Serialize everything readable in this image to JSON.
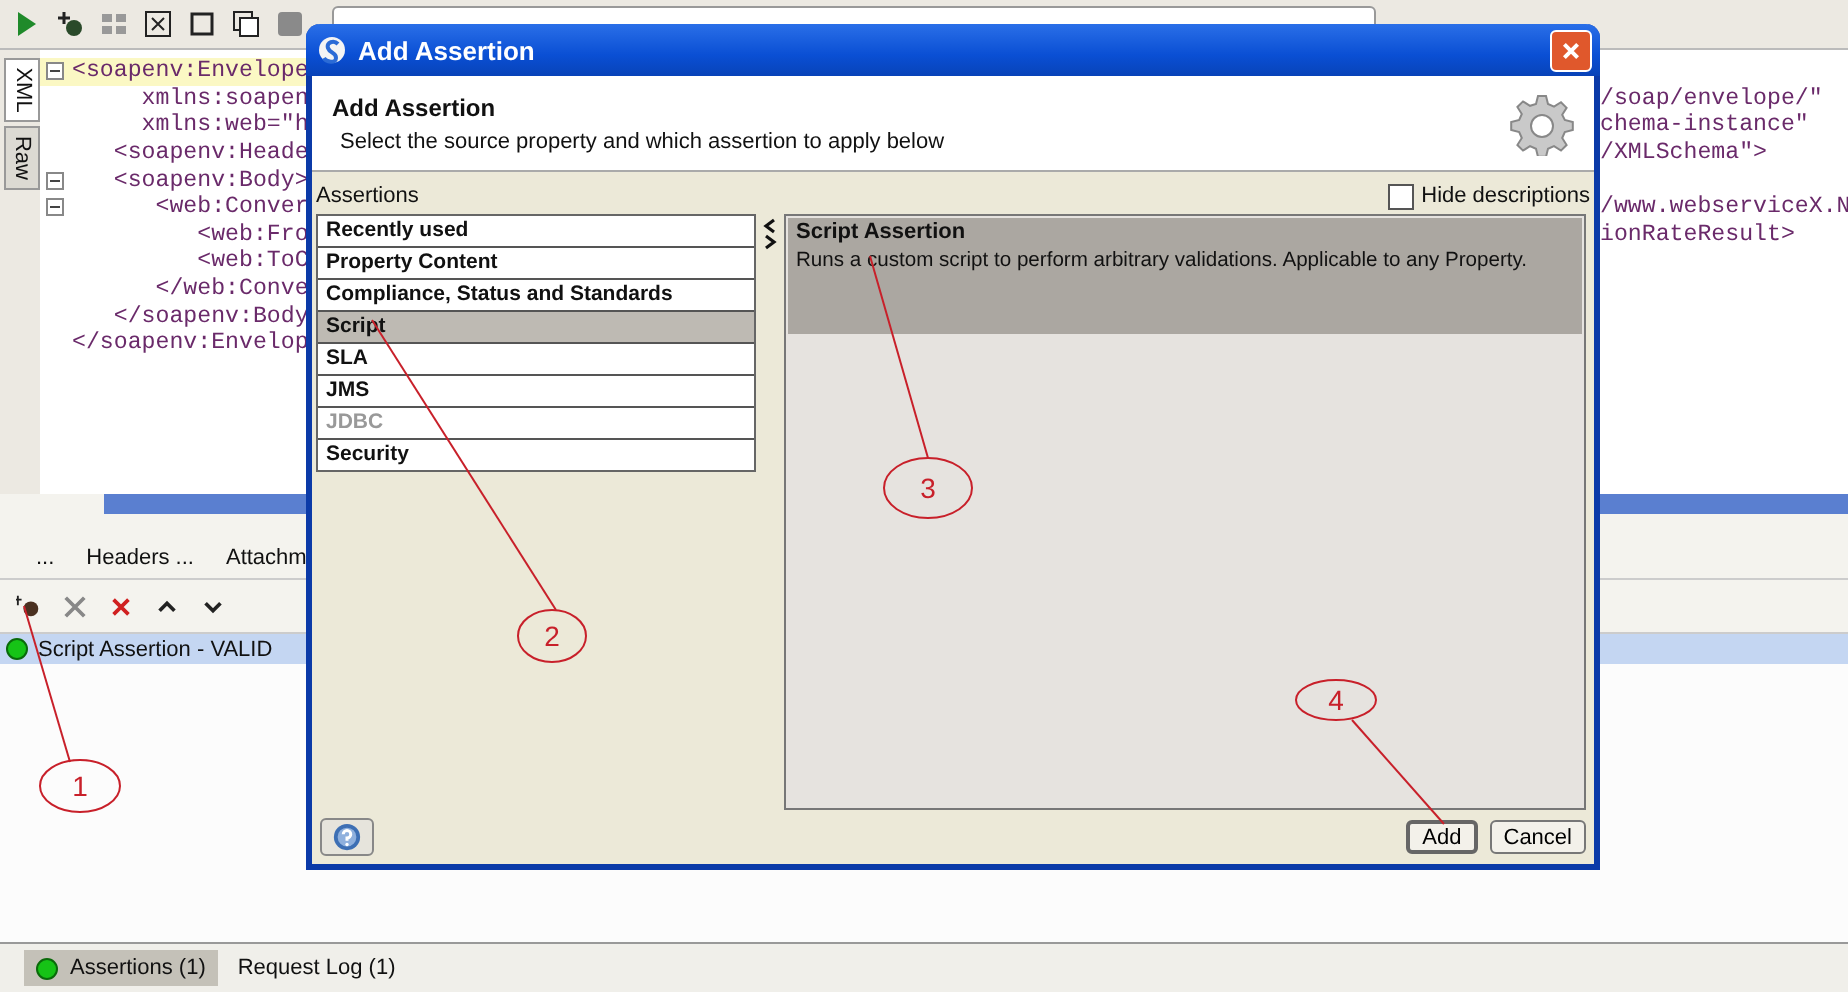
{
  "editor": {
    "side_tabs": [
      {
        "label": "XML",
        "selected": true
      },
      {
        "label": "Raw",
        "selected": false
      }
    ],
    "lines": [
      {
        "text": "<soapenv:Envelope",
        "fold": true,
        "current": true
      },
      {
        "text": "     xmlns:soapen",
        "tail": "/soap/envelope/\"",
        "fold": false,
        "current": false
      },
      {
        "text": "     xmlns:web=\"h",
        "tail": "chema-instance\"",
        "fold": false,
        "current": false
      },
      {
        "text": "   <soapenv:Heade",
        "tail": "/XMLSchema\">",
        "fold": false,
        "current": false
      },
      {
        "text": "   <soapenv:Body>",
        "fold": true,
        "current": false
      },
      {
        "text": "      <web:Conver",
        "tail": "/www.webserviceX.N",
        "fold": true,
        "current": false
      },
      {
        "text": "         <web:Fro",
        "tail": "ionRateResult>",
        "fold": false,
        "current": false
      },
      {
        "text": "         <web:ToC",
        "fold": false,
        "current": false
      },
      {
        "text": "      </web:Conve",
        "fold": false,
        "current": false
      },
      {
        "text": "   </soapenv:Body",
        "fold": false,
        "current": false
      },
      {
        "text": "</soapenv:Envelop",
        "fold": false,
        "current": false
      }
    ]
  },
  "panel_tabs": [
    {
      "label": "..."
    },
    {
      "label": "Headers ..."
    },
    {
      "label": "Attachm"
    }
  ],
  "assertions": [
    {
      "label": "Script Assertion - VALID",
      "selected": true,
      "color": "#16c316"
    }
  ],
  "bottom_tabs": [
    {
      "label": "Assertions (1)",
      "selected": true,
      "kind": "status",
      "color": "#16c316"
    },
    {
      "label": "Request Log (1)",
      "selected": false,
      "kind": "plain"
    }
  ],
  "dialog": {
    "title": "Add Assertion",
    "heading": "Add Assertion",
    "subtitle": "Select the source property and which assertion to apply below",
    "list_label": "Assertions",
    "hide_descriptions": {
      "label": "Hide descriptions",
      "checked": false
    },
    "categories": [
      {
        "label": "Recently used",
        "selected": false,
        "disabled": false
      },
      {
        "label": "Property Content",
        "selected": false,
        "disabled": false
      },
      {
        "label": "Compliance, Status and Standards",
        "selected": false,
        "disabled": false
      },
      {
        "label": "Script",
        "selected": true,
        "disabled": false
      },
      {
        "label": "SLA",
        "selected": false,
        "disabled": false
      },
      {
        "label": "JMS",
        "selected": false,
        "disabled": false
      },
      {
        "label": "JDBC",
        "selected": false,
        "disabled": true
      },
      {
        "label": "Security",
        "selected": false,
        "disabled": false
      }
    ],
    "description": {
      "title": "Script Assertion",
      "text": "Runs a custom script to perform arbitrary validations. Applicable to any Property."
    },
    "buttons": [
      {
        "label": "Add",
        "default": true
      },
      {
        "label": "Cancel",
        "default": false
      }
    ]
  },
  "callouts": [
    {
      "label": "1"
    },
    {
      "label": "2"
    },
    {
      "label": "3"
    },
    {
      "label": "4"
    }
  ]
}
